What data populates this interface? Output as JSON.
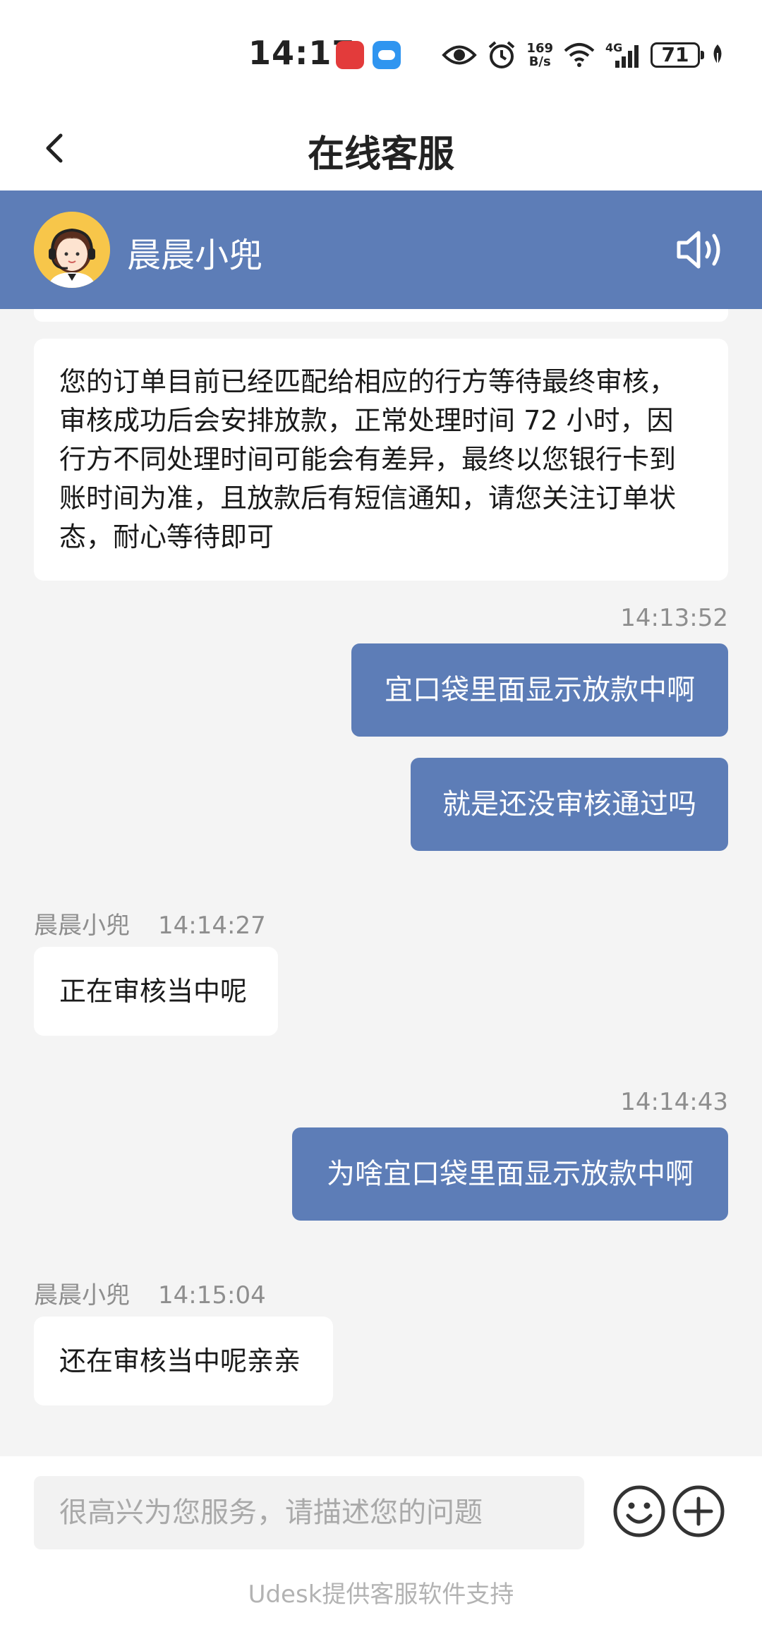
{
  "status_bar": {
    "time": "14:17",
    "net_speed_value": "169",
    "net_speed_unit": "B/s",
    "network_type": "4G",
    "battery_level": "71",
    "icons": [
      "app-notification-icon",
      "cloud-app-icon",
      "eye-icon",
      "alarm-icon",
      "wifi-icon",
      "cellular-signal-icon",
      "battery-icon",
      "leaf-icon"
    ]
  },
  "header": {
    "title": "在线客服"
  },
  "agent": {
    "name": "晨晨小兜"
  },
  "messages": [
    {
      "sender": "agent",
      "text_lines": [
        "您的订单目前已经匹配给相应的行方等待最终审核，",
        "审核成功后会安排放款，正常处理时间 72 小时，因",
        "行方不同处理时间可能会有差异，最终以您银行卡到",
        "账时间为准，且放款后有短信通知，请您关注订单状",
        "态，耐心等待即可"
      ]
    },
    {
      "sender": "user",
      "time": "14:13:52",
      "text": "宜口袋里面显示放款中啊"
    },
    {
      "sender": "user",
      "text": "就是还没审核通过吗"
    },
    {
      "sender": "agent",
      "name": "晨晨小兜",
      "time": "14:14:27",
      "text": "正在审核当中呢"
    },
    {
      "sender": "user",
      "time": "14:14:43",
      "text": "为啥宜口袋里面显示放款中啊"
    },
    {
      "sender": "agent",
      "name": "晨晨小兜",
      "time": "14:15:04",
      "text": "还在审核当中呢亲亲"
    }
  ],
  "input": {
    "placeholder": "很高兴为您服务，请描述您的问题",
    "value": ""
  },
  "footer": {
    "text": "Udesk提供客服软件支持"
  },
  "colors": {
    "accent": "#5d7db7",
    "background": "#f4f4f4",
    "bubble_in": "#ffffff",
    "timestamp": "#8e8e8e"
  }
}
